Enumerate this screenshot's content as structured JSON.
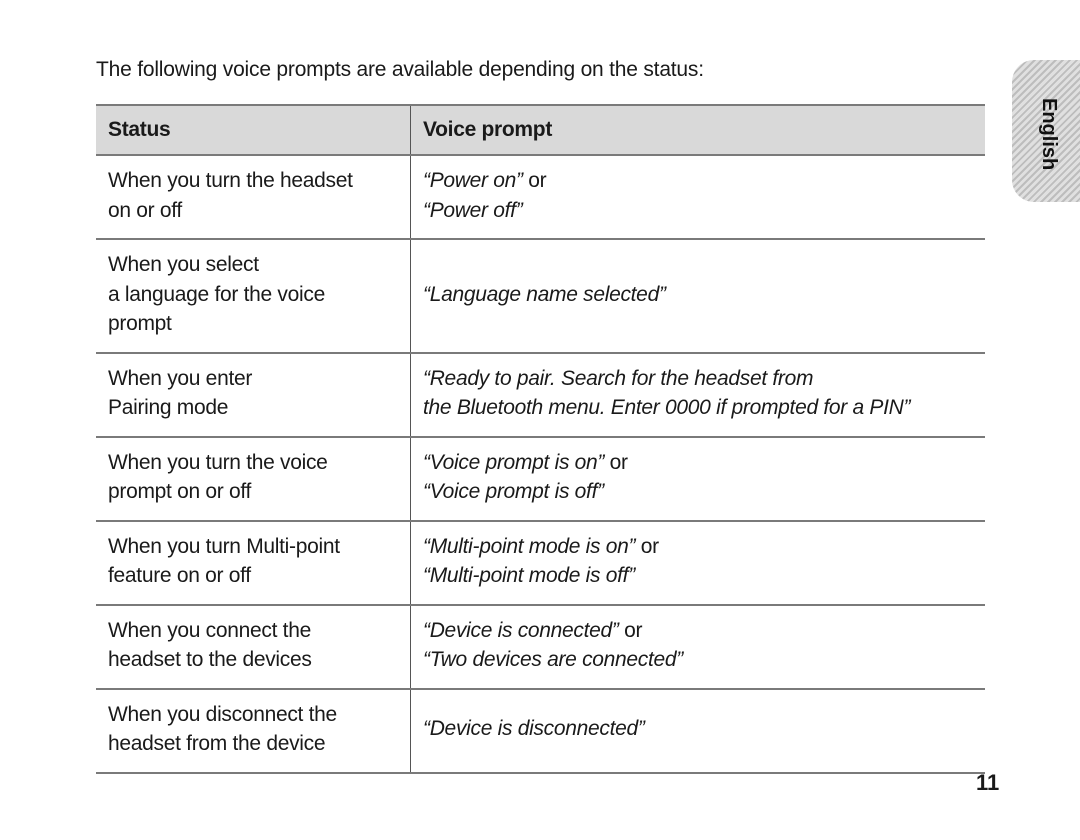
{
  "intro": "The following voice prompts are available depending on the status:",
  "table": {
    "headers": [
      "Status",
      "Voice prompt"
    ],
    "rows": [
      {
        "status": [
          "When you turn the headset",
          "on or off"
        ],
        "prompt": [
          "“Power on”",
          "“Power off”"
        ],
        "connector": " or"
      },
      {
        "status": [
          "When you select",
          "a language for the voice",
          "prompt"
        ],
        "prompt": [
          "“Language name selected”"
        ]
      },
      {
        "status": [
          "When you enter",
          "Pairing mode"
        ],
        "prompt": [
          "“Ready to pair. Search for the headset from",
          "the Bluetooth menu. Enter 0000 if prompted for a PIN”"
        ]
      },
      {
        "status": [
          "When you turn the voice",
          "prompt on or off"
        ],
        "prompt": [
          "“Voice prompt is on”",
          "“Voice prompt is off”"
        ],
        "connector": " or"
      },
      {
        "status": [
          "When you turn Multi-point",
          "feature on or off"
        ],
        "prompt": [
          "“Multi-point mode is on”",
          "“Multi-point mode is off”"
        ],
        "connector": " or"
      },
      {
        "status": [
          "When you connect the",
          "headset to the devices"
        ],
        "prompt": [
          "“Device is connected”",
          "“Two devices are connected”"
        ],
        "connector": " or"
      },
      {
        "status": [
          "When you disconnect the",
          "headset from the device"
        ],
        "prompt": [
          "“Device is disconnected”"
        ]
      }
    ]
  },
  "language_tab": "English",
  "page_number": "11"
}
